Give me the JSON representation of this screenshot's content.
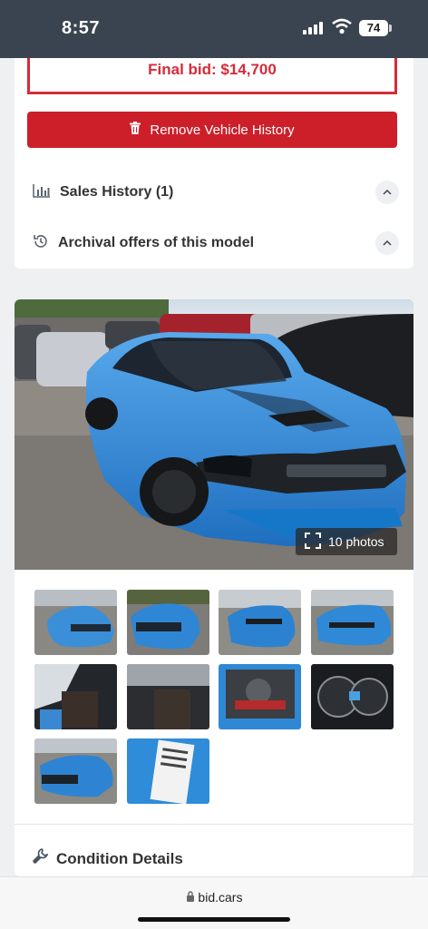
{
  "status_bar": {
    "time": "8:57",
    "battery": "74"
  },
  "listing": {
    "final_bid": "Final bid: $14,700",
    "remove_history_label": "Remove Vehicle History",
    "sales_history_label": "Sales History (1)",
    "archival_label": "Archival offers of this model"
  },
  "gallery": {
    "photo_count_label": "10 photos",
    "thumbnail_count": 10
  },
  "condition": {
    "title": "Condition Details"
  },
  "browser": {
    "url": "bid.cars"
  },
  "colors": {
    "accent_red": "#cc1f2a",
    "car_blue": "#2f8bd8",
    "status_bar": "#3a4450"
  }
}
